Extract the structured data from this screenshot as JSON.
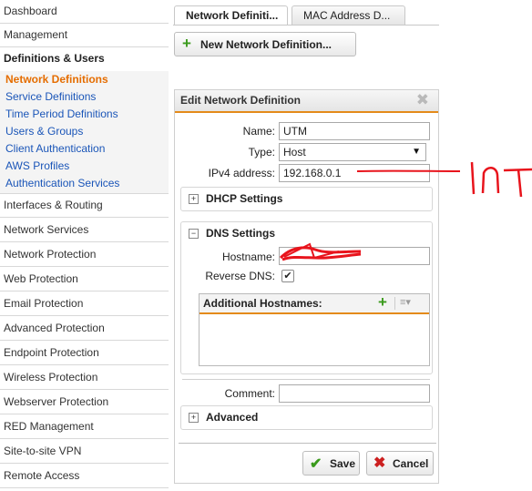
{
  "sidebar": {
    "items_top": [
      {
        "label": "Dashboard"
      },
      {
        "label": "Management"
      }
    ],
    "section_label": "Definitions & Users",
    "subitems": [
      {
        "label": "Network Definitions"
      },
      {
        "label": "Service Definitions"
      },
      {
        "label": "Time Period Definitions"
      },
      {
        "label": "Users & Groups"
      },
      {
        "label": "Client Authentication"
      },
      {
        "label": "AWS Profiles"
      },
      {
        "label": "Authentication Services"
      }
    ],
    "items_bottom": [
      {
        "label": "Interfaces & Routing"
      },
      {
        "label": "Network Services"
      },
      {
        "label": "Network Protection"
      },
      {
        "label": "Web Protection"
      },
      {
        "label": "Email Protection"
      },
      {
        "label": "Advanced Protection"
      },
      {
        "label": "Endpoint Protection"
      },
      {
        "label": "Wireless Protection"
      },
      {
        "label": "Webserver Protection"
      },
      {
        "label": "RED Management"
      },
      {
        "label": "Site-to-site VPN"
      },
      {
        "label": "Remote Access"
      }
    ]
  },
  "tabs": [
    {
      "label": "Network Definiti..."
    },
    {
      "label": "MAC Address D..."
    }
  ],
  "new_button_label": "New Network Definition...",
  "dialog": {
    "title": "Edit Network Definition",
    "name_label": "Name:",
    "name_value": "UTM",
    "type_label": "Type:",
    "type_value": "Host",
    "ipv4_label": "IPv4 address:",
    "ipv4_value": "192.168.0.1",
    "dhcp_label": "DHCP Settings",
    "dns_label": "DNS Settings",
    "hostname_label": "Hostname:",
    "reverse_dns_label": "Reverse DNS:",
    "additional_hostnames_label": "Additional Hostnames:",
    "comment_label": "Comment:",
    "comment_value": "",
    "advanced_label": "Advanced",
    "save_label": "Save",
    "cancel_label": "Cancel"
  },
  "annotation": {
    "handwritten_text": "INT",
    "color": "#e8141c"
  },
  "colors": {
    "accent": "#e48a1a",
    "link": "#1a55b8",
    "active": "#e56d00",
    "green": "#3a9a1c",
    "red": "#cc2020"
  }
}
